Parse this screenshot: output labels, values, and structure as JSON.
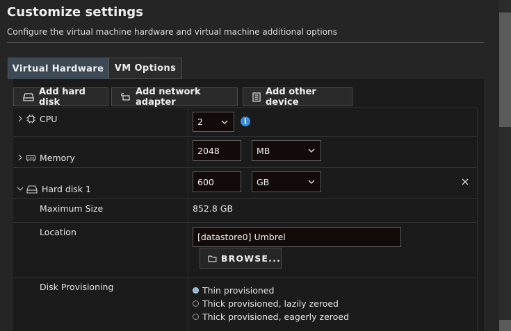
{
  "header": {
    "title": "Customize settings",
    "subtitle": "Configure the virtual machine hardware and virtual machine additional options"
  },
  "tabs": [
    {
      "label": "Virtual Hardware",
      "active": true
    },
    {
      "label": "VM Options",
      "active": false
    }
  ],
  "toolbar": {
    "add_hard_disk": "Add hard disk",
    "add_network_adapter": "Add network adapter",
    "add_other_device": "Add other device"
  },
  "cpu": {
    "label": "CPU",
    "value": "2"
  },
  "memory": {
    "label": "Memory",
    "value": "2048",
    "unit": "MB"
  },
  "hard_disk": {
    "label": "Hard disk 1",
    "size": "600",
    "unit": "GB",
    "max_size_label": "Maximum Size",
    "max_size_value": "852.8 GB",
    "location_label": "Location",
    "location_value": "[datastore0] Umbrel",
    "browse_label": "BROWSE...",
    "provisioning_label": "Disk Provisioning",
    "provisioning_options": [
      {
        "label": "Thin provisioned",
        "selected": true
      },
      {
        "label": "Thick provisioned, lazily zeroed",
        "selected": false
      },
      {
        "label": "Thick provisioned, eagerly zeroed",
        "selected": false
      }
    ]
  },
  "colors": {
    "accent": "#3b8fd9",
    "active_tab": "#3d4a55"
  },
  "icons": [
    "hard-disk-icon",
    "network-adapter-icon",
    "device-icon",
    "cpu-icon",
    "memory-icon",
    "info-icon",
    "close-icon",
    "folder-icon",
    "chevron-down-icon",
    "chevron-right-icon"
  ]
}
